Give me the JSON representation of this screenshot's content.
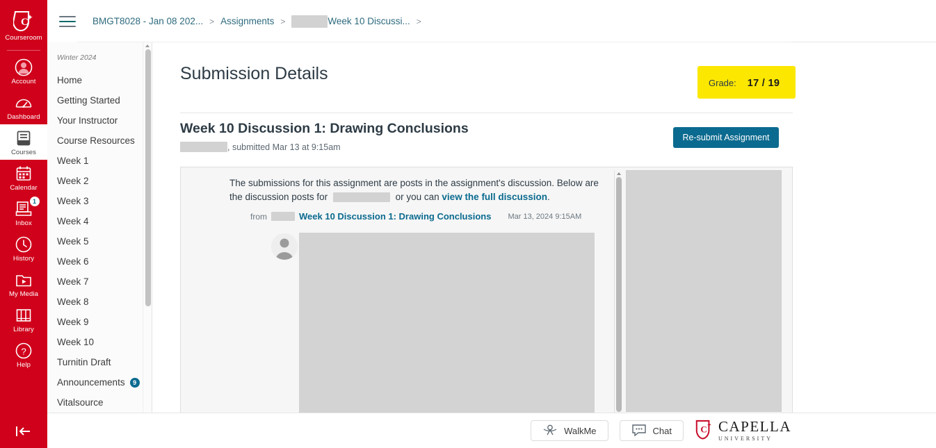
{
  "global_nav": {
    "logo": {
      "label": "Courseroom",
      "icon": "capella-shield-icon"
    },
    "items": [
      {
        "label": "Account",
        "icon": "account-avatar-icon",
        "active": false,
        "badge": ""
      },
      {
        "label": "Dashboard",
        "icon": "dashboard-gauge-icon",
        "active": false,
        "badge": ""
      },
      {
        "label": "Courses",
        "icon": "courses-book-icon",
        "active": true,
        "badge": ""
      },
      {
        "label": "Calendar",
        "icon": "calendar-icon",
        "active": false,
        "badge": ""
      },
      {
        "label": "Inbox",
        "icon": "inbox-tray-icon",
        "active": false,
        "badge": "1"
      },
      {
        "label": "History",
        "icon": "history-clock-icon",
        "active": false,
        "badge": ""
      },
      {
        "label": "My Media",
        "icon": "my-media-play-icon",
        "active": false,
        "badge": ""
      },
      {
        "label": "Library",
        "icon": "library-books-icon",
        "active": false,
        "badge": ""
      },
      {
        "label": "Help",
        "icon": "help-question-icon",
        "active": false,
        "badge": ""
      }
    ],
    "collapse_icon": "collapse-left-arrow-icon"
  },
  "breadcrumb": {
    "menu_icon": "hamburger-menu-icon",
    "items": [
      {
        "label": "BMGT8028 - Jan 08 202...",
        "redacted": false
      },
      {
        "label": "Assignments",
        "redacted": false
      },
      {
        "label": "Week 10 Discussi...",
        "redacted": true
      }
    ],
    "separator": ">"
  },
  "course_nav": {
    "term": "Winter 2024",
    "items": [
      {
        "label": "Home",
        "badge": ""
      },
      {
        "label": "Getting Started",
        "badge": ""
      },
      {
        "label": "Your Instructor",
        "badge": ""
      },
      {
        "label": "Course Resources",
        "badge": ""
      },
      {
        "label": "Week 1",
        "badge": ""
      },
      {
        "label": "Week 2",
        "badge": ""
      },
      {
        "label": "Week 3",
        "badge": ""
      },
      {
        "label": "Week 4",
        "badge": ""
      },
      {
        "label": "Week 5",
        "badge": ""
      },
      {
        "label": "Week 6",
        "badge": ""
      },
      {
        "label": "Week 7",
        "badge": ""
      },
      {
        "label": "Week 8",
        "badge": ""
      },
      {
        "label": "Week 9",
        "badge": ""
      },
      {
        "label": "Week 10",
        "badge": ""
      },
      {
        "label": "Turnitin Draft",
        "badge": ""
      },
      {
        "label": "Announcements",
        "badge": "9"
      },
      {
        "label": "Vitalsource",
        "badge": ""
      }
    ]
  },
  "main": {
    "page_title": "Submission Details",
    "grade": {
      "label": "Grade:",
      "value": "17 / 19",
      "highlight_color": "#fbe700"
    },
    "assignment": {
      "title": "Week 10 Discussion 1: Drawing Conclusions",
      "submitted_text": ", submitted Mar 13 at 9:15am",
      "resubmit_label": "Re-submit Assignment"
    },
    "submission_panel": {
      "intro_part1": "The submissions for this assignment are posts in the assignment's discussion. Below are the discussion posts for",
      "intro_part2": "or you can",
      "full_discussion_link": "view the full discussion",
      "intro_end": ".",
      "post_from_label": "from",
      "post_title": "Week 10 Discussion 1: Drawing Conclusions",
      "post_date": "Mar 13, 2024 9:15AM"
    }
  },
  "footer": {
    "walkme_label": "WalkMe",
    "walkme_icon": "walkme-icon",
    "chat_label": "Chat",
    "chat_icon": "chat-bubble-icon",
    "logo_line1": "CAPELLA",
    "logo_line2": "UNIVERSITY",
    "logo_icon": "capella-shield-icon"
  },
  "colors": {
    "brand_red": "#d0021b",
    "accent_blue": "#0b6a8f",
    "highlight_yellow": "#fbe700"
  }
}
